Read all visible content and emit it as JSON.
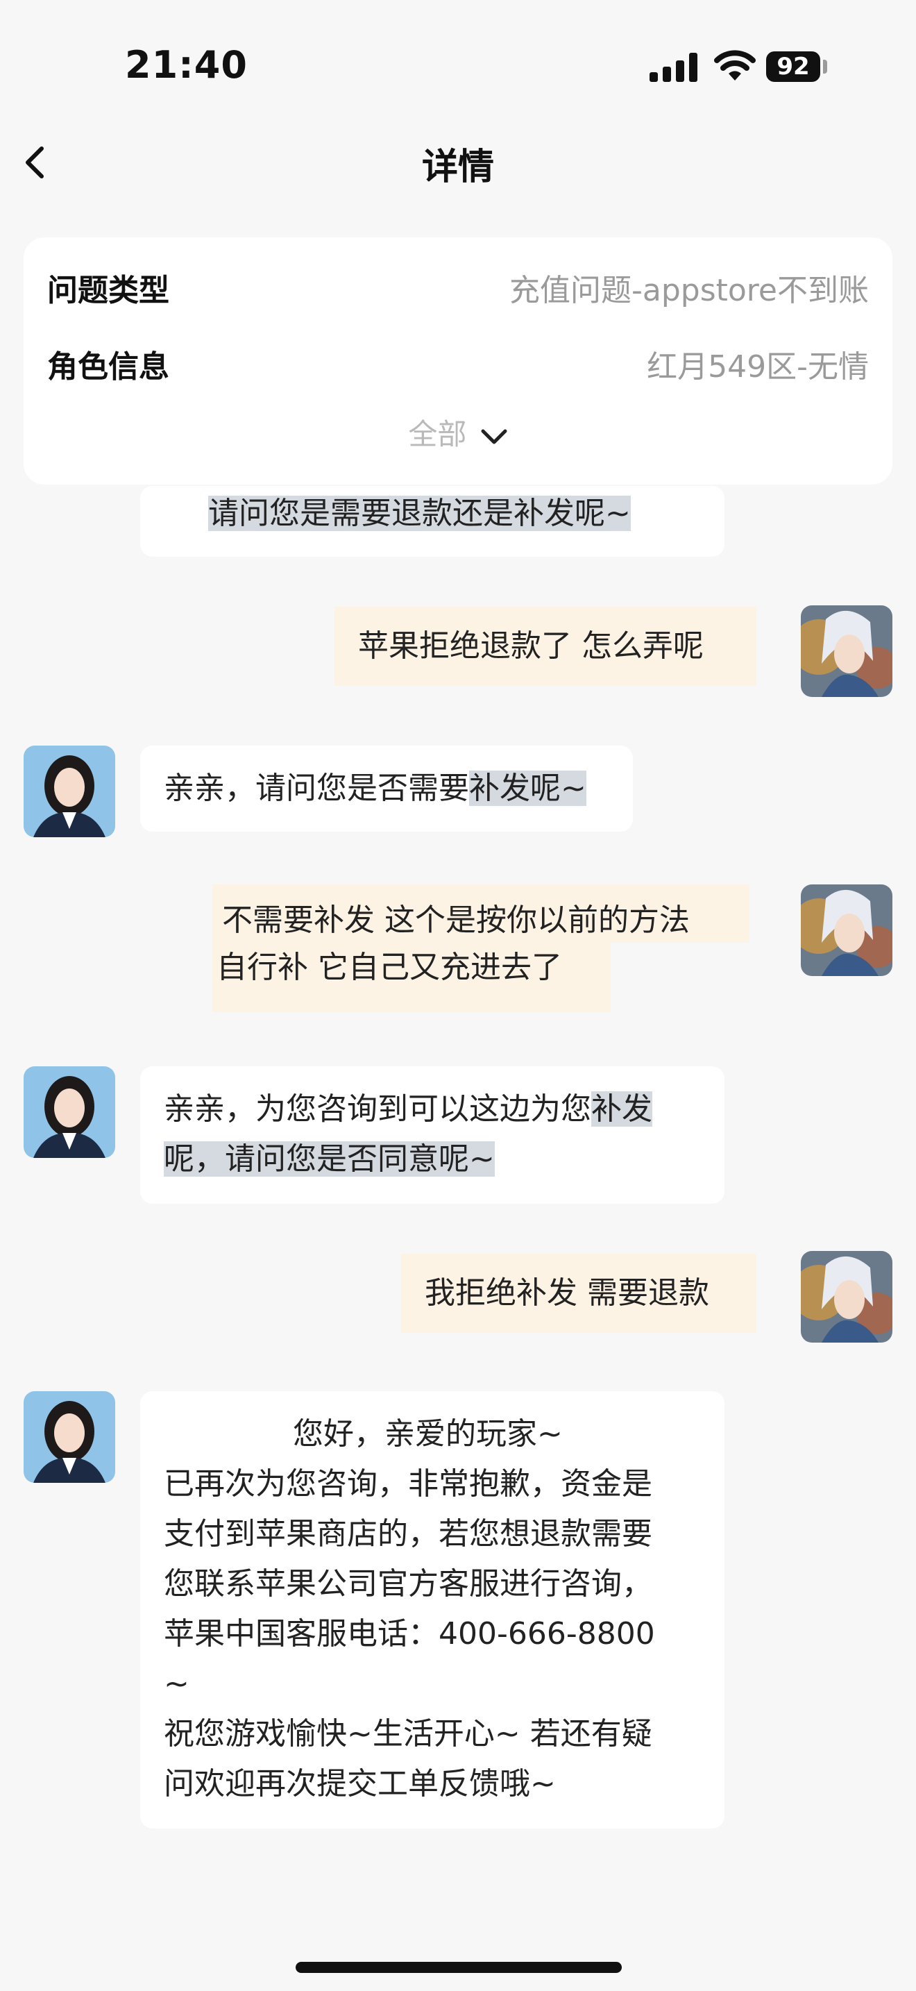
{
  "status": {
    "time": "21:40",
    "battery": "92"
  },
  "nav": {
    "title": "详情"
  },
  "info": {
    "rows": [
      {
        "label": "问题类型",
        "value": "充值问题-appstore不到账"
      },
      {
        "label": "角色信息",
        "value": "红月549区-无情"
      }
    ],
    "expand_label": "全部"
  },
  "chat": {
    "m0": {
      "line1": "请问您是需要退款还是补发呢~"
    },
    "m1": {
      "text": "苹果拒绝退款了 怎么弄呢"
    },
    "m2": {
      "plain": "亲亲，请问您是否需要",
      "highlight": "补发呢~"
    },
    "m3": {
      "line1": " 不需要补发 这个是按你以前的方法",
      "line2": "自行补 它自己又充进去了"
    },
    "m4": {
      "line1_plain": "亲亲，为您咨询到可以这边为您",
      "line1_highlight": "补发",
      "line2_highlight": "呢，请问您是否同意呢~"
    },
    "m5": {
      "text": "我拒绝补发 需要退款"
    },
    "m6": {
      "greeting": "您好，亲爱的玩家~",
      "lines": [
        "已再次为您咨询，非常抱歉，资金是",
        "支付到苹果商店的，若您想退款需要",
        "您联系苹果公司官方客服进行咨询，",
        "苹果中国客服电话：400-666-8800",
        "~",
        "祝您游戏愉快~生活开心~ 若还有疑",
        "问欢迎再次提交工单反馈哦~"
      ]
    }
  }
}
